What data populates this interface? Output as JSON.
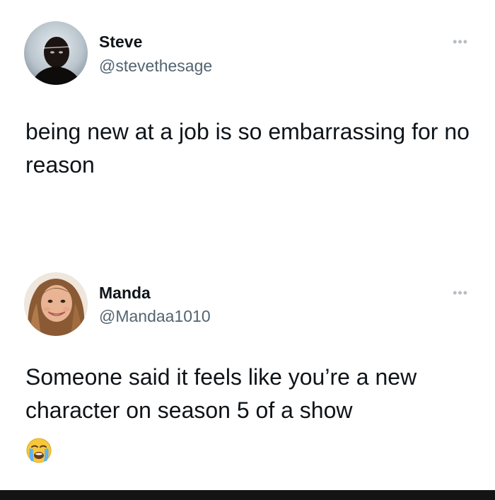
{
  "tweets": [
    {
      "display_name": "Steve",
      "handle": "@stevethesage",
      "text": "being new at a job is so embarrassing for no reason",
      "more_glyph": "•••",
      "avatar_icon": "steve-profile-photo"
    },
    {
      "display_name": "Manda",
      "handle": "@Mandaa1010",
      "text": "Someone said it feels like you’re a new character on season 5 of a show",
      "more_glyph": "•••",
      "avatar_icon": "manda-profile-photo",
      "emoji_icon": "loudly-crying-face-emoji"
    }
  ],
  "colors": {
    "text": "#0f1419",
    "secondary_text": "#536471",
    "more_icon": "#b7bec4",
    "bottom_bar": "#141414"
  }
}
